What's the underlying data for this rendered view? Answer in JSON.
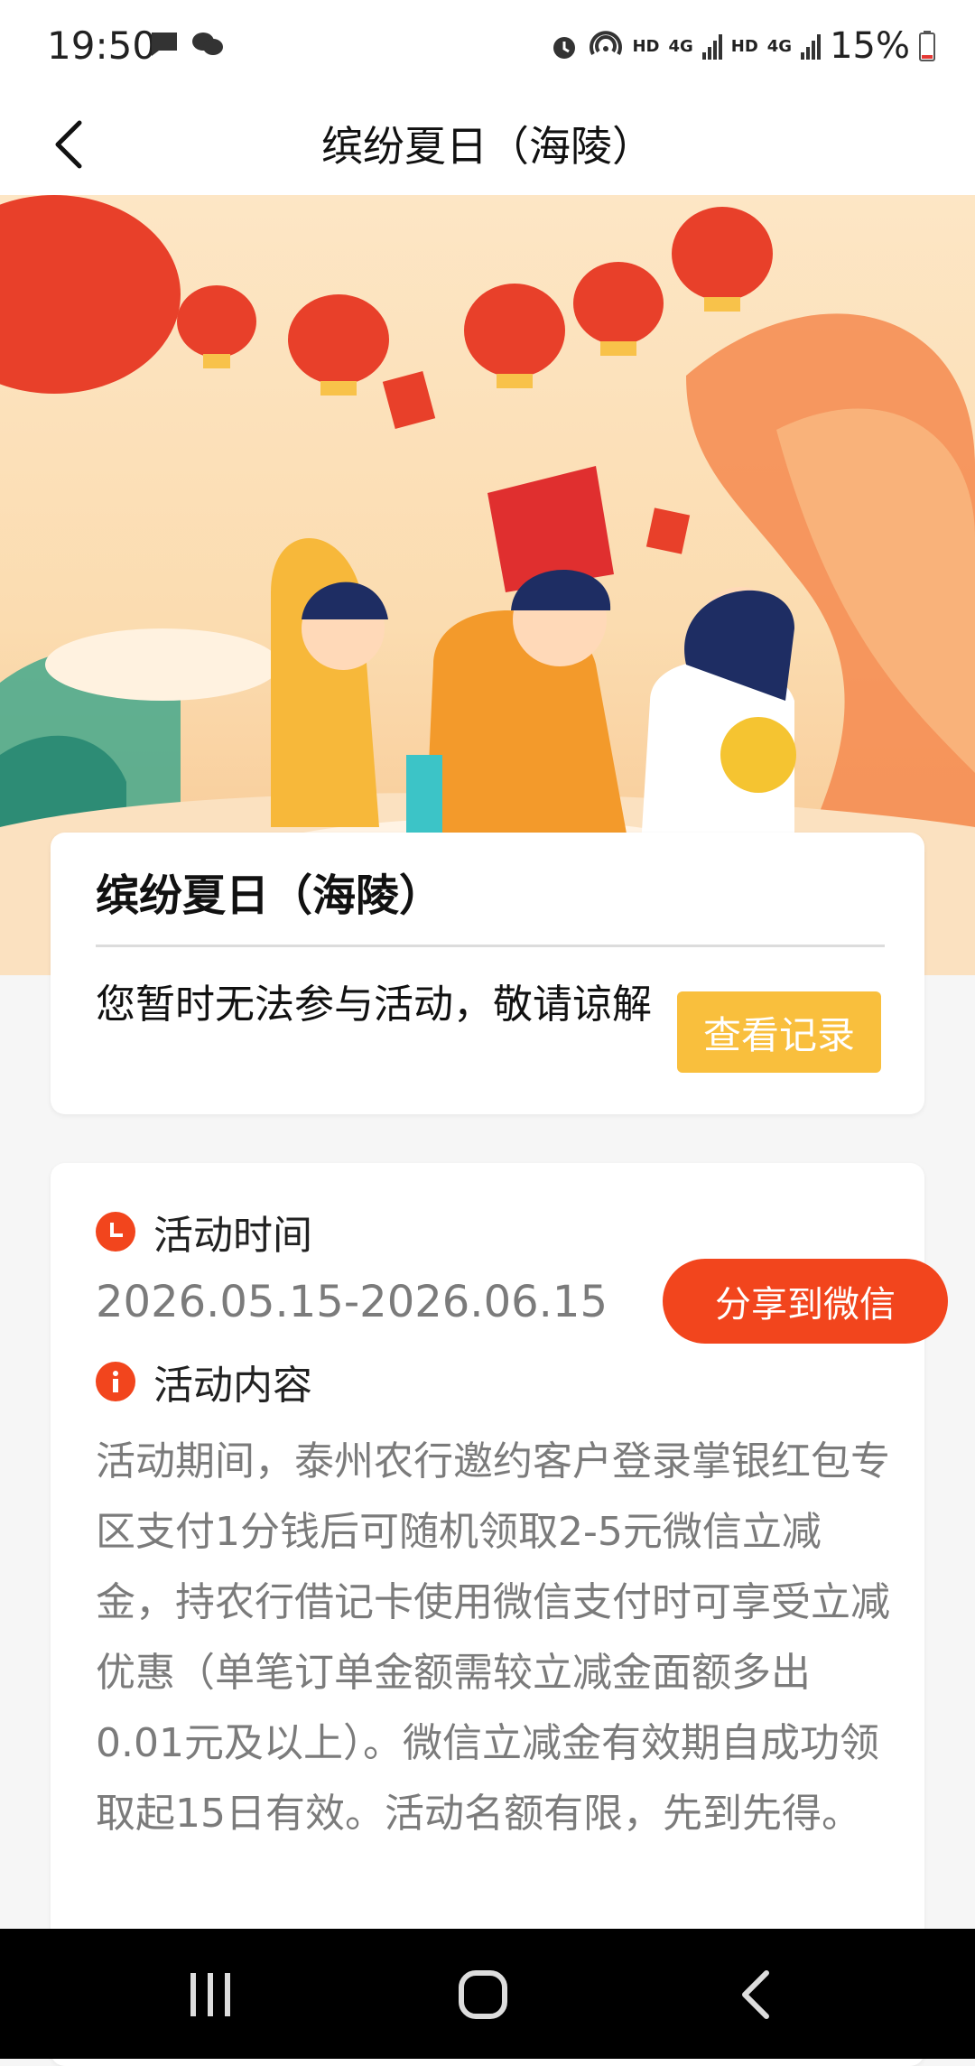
{
  "status_bar": {
    "time": "19:50",
    "battery": "15%",
    "hd1": "HD",
    "net1": "4G",
    "hd2": "HD",
    "net2": "4G",
    "icons": [
      "message-icon",
      "wechat-icon",
      "alarm-icon",
      "hotspot-icon",
      "signal-icon",
      "battery-icon"
    ]
  },
  "nav": {
    "title": "缤纷夏日（海陵）"
  },
  "card_status": {
    "title": "缤纷夏日（海陵）",
    "message": "您暂时无法参与活动，敬请谅解",
    "records_button": "查看记录"
  },
  "activity": {
    "time_label": "活动时间",
    "date_range": "2026.05.15-2026.06.15",
    "share_button": "分享到微信",
    "content_label": "活动内容",
    "description": "活动期间，泰州农行邀约客户登录掌银红包专区支付1分钱后可随机领取2-5元微信立减金，持农行借记卡使用微信支付时可享受立减优惠（单笔订单金额需较立减金面额多出0.01元及以上）。微信立减金有效期自成功领取起15日有效。活动名额有限，先到先得。"
  },
  "colors": {
    "accent": "#f2451d",
    "records_button": "#f9bf3d",
    "muted_text": "#7b7b7b"
  }
}
